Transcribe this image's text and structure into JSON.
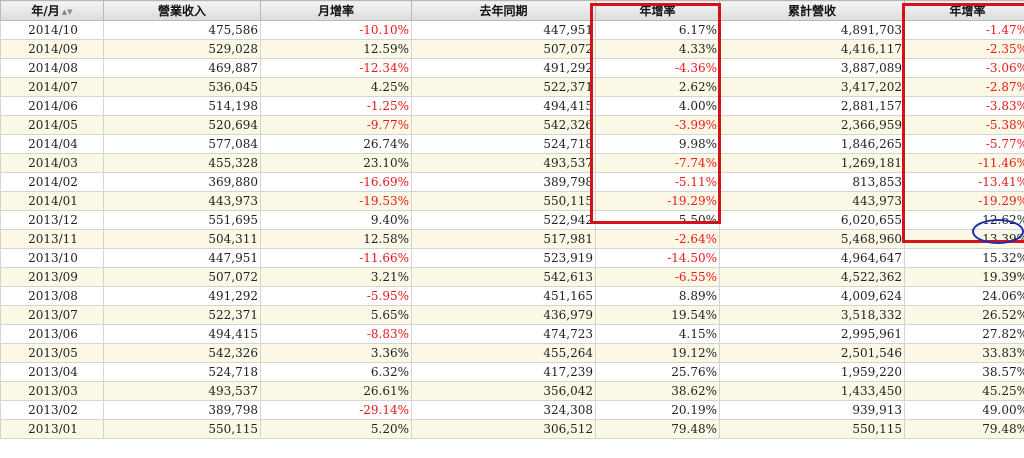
{
  "headers": [
    "年/月",
    "營業收入",
    "月增率",
    "去年同期",
    "年增率",
    "累計營收",
    "年增率"
  ],
  "sort_icon": "sort-arrows-icon",
  "highlight_color": "#d4121c",
  "circle_color": "#1a2fb0",
  "negative_color": "#e8191a",
  "rows": [
    [
      "2014/10",
      "475,586",
      "-10.10%",
      "447,951",
      "6.17%",
      "4,891,703",
      "-1.47%"
    ],
    [
      "2014/09",
      "529,028",
      "12.59%",
      "507,072",
      "4.33%",
      "4,416,117",
      "-2.35%"
    ],
    [
      "2014/08",
      "469,887",
      "-12.34%",
      "491,292",
      "-4.36%",
      "3,887,089",
      "-3.06%"
    ],
    [
      "2014/07",
      "536,045",
      "4.25%",
      "522,371",
      "2.62%",
      "3,417,202",
      "-2.87%"
    ],
    [
      "2014/06",
      "514,198",
      "-1.25%",
      "494,415",
      "4.00%",
      "2,881,157",
      "-3.83%"
    ],
    [
      "2014/05",
      "520,694",
      "-9.77%",
      "542,326",
      "-3.99%",
      "2,366,959",
      "-5.38%"
    ],
    [
      "2014/04",
      "577,084",
      "26.74%",
      "524,718",
      "9.98%",
      "1,846,265",
      "-5.77%"
    ],
    [
      "2014/03",
      "455,328",
      "23.10%",
      "493,537",
      "-7.74%",
      "1,269,181",
      "-11.46%"
    ],
    [
      "2014/02",
      "369,880",
      "-16.69%",
      "389,798",
      "-5.11%",
      "813,853",
      "-13.41%"
    ],
    [
      "2014/01",
      "443,973",
      "-19.53%",
      "550,115",
      "-19.29%",
      "443,973",
      "-19.29%"
    ],
    [
      "2013/12",
      "551,695",
      "9.40%",
      "522,942",
      "5.50%",
      "6,020,655",
      "12.62%"
    ],
    [
      "2013/11",
      "504,311",
      "12.58%",
      "517,981",
      "-2.64%",
      "5,468,960",
      "13.39%"
    ],
    [
      "2013/10",
      "447,951",
      "-11.66%",
      "523,919",
      "-14.50%",
      "4,964,647",
      "15.32%"
    ],
    [
      "2013/09",
      "507,072",
      "3.21%",
      "542,613",
      "-6.55%",
      "4,522,362",
      "19.39%"
    ],
    [
      "2013/08",
      "491,292",
      "-5.95%",
      "451,165",
      "8.89%",
      "4,009,624",
      "24.06%"
    ],
    [
      "2013/07",
      "522,371",
      "5.65%",
      "436,979",
      "19.54%",
      "3,518,332",
      "26.52%"
    ],
    [
      "2013/06",
      "494,415",
      "-8.83%",
      "474,723",
      "4.15%",
      "2,995,961",
      "27.82%"
    ],
    [
      "2013/05",
      "542,326",
      "3.36%",
      "455,264",
      "19.12%",
      "2,501,546",
      "33.83%"
    ],
    [
      "2013/04",
      "524,718",
      "6.32%",
      "417,239",
      "25.76%",
      "1,959,220",
      "38.57%"
    ],
    [
      "2013/03",
      "493,537",
      "26.61%",
      "356,042",
      "38.62%",
      "1,433,450",
      "45.25%"
    ],
    [
      "2013/02",
      "389,798",
      "-29.14%",
      "324,308",
      "20.19%",
      "939,913",
      "49.00%"
    ],
    [
      "2013/01",
      "550,115",
      "5.20%",
      "306,512",
      "79.48%",
      "550,115",
      "79.48%"
    ]
  ]
}
